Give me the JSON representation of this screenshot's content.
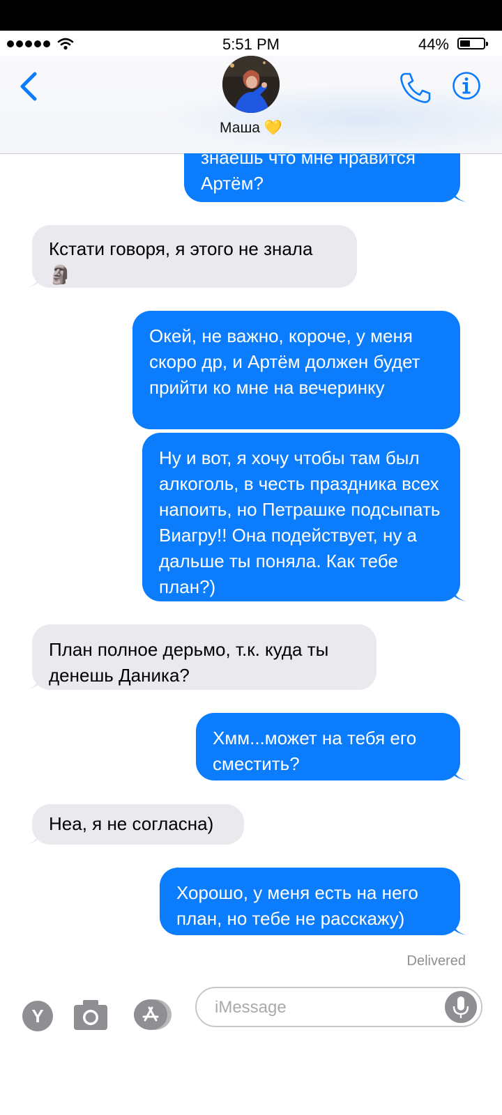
{
  "status_bar": {
    "time": "5:51 PM",
    "battery": "44%",
    "battery_level": 0.44
  },
  "header": {
    "contact_name": "Маша",
    "contact_emoji": "💛"
  },
  "messages": [
    {
      "dir": "out",
      "text": "знаешь что мне нравится Артём?"
    },
    {
      "dir": "in",
      "text": "Кстати говоря, я этого не знала 🗿"
    },
    {
      "dir": "out",
      "text": "Окей, не важно, короче, у меня скоро др, и Артём должен будет прийти ко мне на вечеринку"
    },
    {
      "dir": "out",
      "text": "Ну и вот, я хочу чтобы там был алкоголь, в честь праздника всех напоить, но Петрашке подсыпать Виагру!! Она подействует, ну а дальше ты поняла. Как тебе план?)"
    },
    {
      "dir": "in",
      "text": "План полное дерьмо, т.к. куда ты денешь Даника?"
    },
    {
      "dir": "out",
      "text": "Хмм...может на тебя его сместить?"
    },
    {
      "dir": "in",
      "text": "Неа, я не согласна)"
    },
    {
      "dir": "out",
      "text": "Хорошо, у меня есть на него план, но тебе не расскажу)"
    }
  ],
  "delivered_label": "Delivered",
  "composer": {
    "placeholder": "iMessage",
    "app_button_letter": "Y"
  },
  "colors": {
    "outgoing": "#0b7cfb",
    "incoming": "#e9e9ee",
    "accent": "#0a7aff"
  },
  "icons": [
    "back-chevron-icon",
    "phone-icon",
    "info-icon",
    "camera-icon",
    "app-store-icon",
    "microphone-icon",
    "wifi-icon"
  ]
}
